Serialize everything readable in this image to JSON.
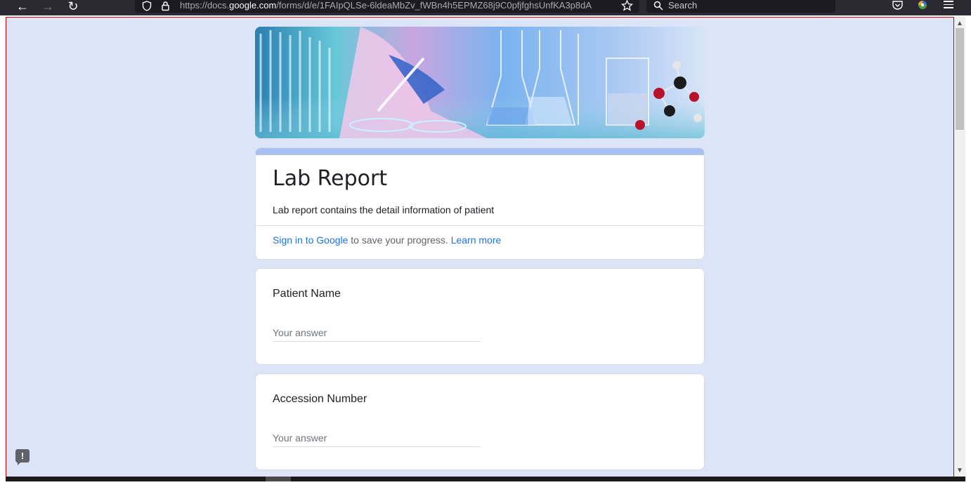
{
  "browser": {
    "url_prefix": "https://docs.",
    "url_host": "google.com",
    "url_path": "/forms/d/e/1FAIpQLSe-6ldeaMbZv_fWBn4h5EPMZ68j9C0pfjfghsUnfKA3p8dA",
    "search_placeholder": "Search",
    "back_icon": "←",
    "forward_icon": "→",
    "reload_icon": "↻"
  },
  "form": {
    "title": "Lab Report",
    "description": "Lab report contains the detail information of patient",
    "signin_link": "Sign in to Google",
    "signin_suffix": " to save your progress. ",
    "learn_more": "Learn more"
  },
  "questions": [
    {
      "label": "Patient Name",
      "placeholder": "Your answer"
    },
    {
      "label": "Accession Number",
      "placeholder": "Your answer"
    }
  ],
  "colors": {
    "background": "#dbe5f7",
    "accent_stripe": "#a8c1f0",
    "link": "#1a73e8"
  }
}
